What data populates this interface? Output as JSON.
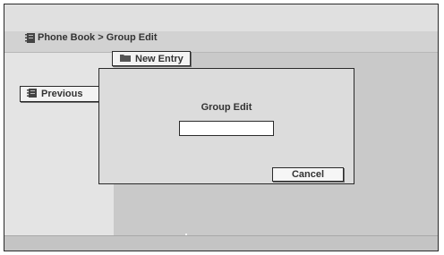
{
  "header": {
    "title": "Phone Book > Group Edit",
    "icon": "phone-book-icon"
  },
  "toolbar": {
    "new_entry_label": "New Entry",
    "new_entry_icon": "folder-icon"
  },
  "sidebar": {
    "previous_label": "Previous",
    "previous_icon": "phone-book-icon"
  },
  "dialog": {
    "title": "Group Edit",
    "input_value": "",
    "cancel_label": "Cancel"
  }
}
